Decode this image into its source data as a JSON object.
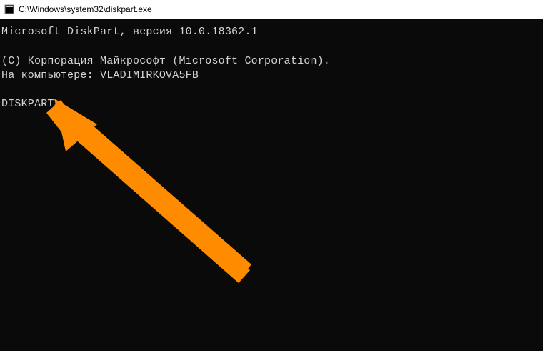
{
  "window": {
    "title": "C:\\Windows\\system32\\diskpart.exe"
  },
  "console": {
    "line1": "Microsoft DiskPart, версия 10.0.18362.1",
    "blank1": "",
    "line2": "(C) Корпорация Майкрософт (Microsoft Corporation).",
    "line3": "На компьютере: VLADIMIRKOVA5FB",
    "blank2": "",
    "prompt": "DISKPART>"
  }
}
